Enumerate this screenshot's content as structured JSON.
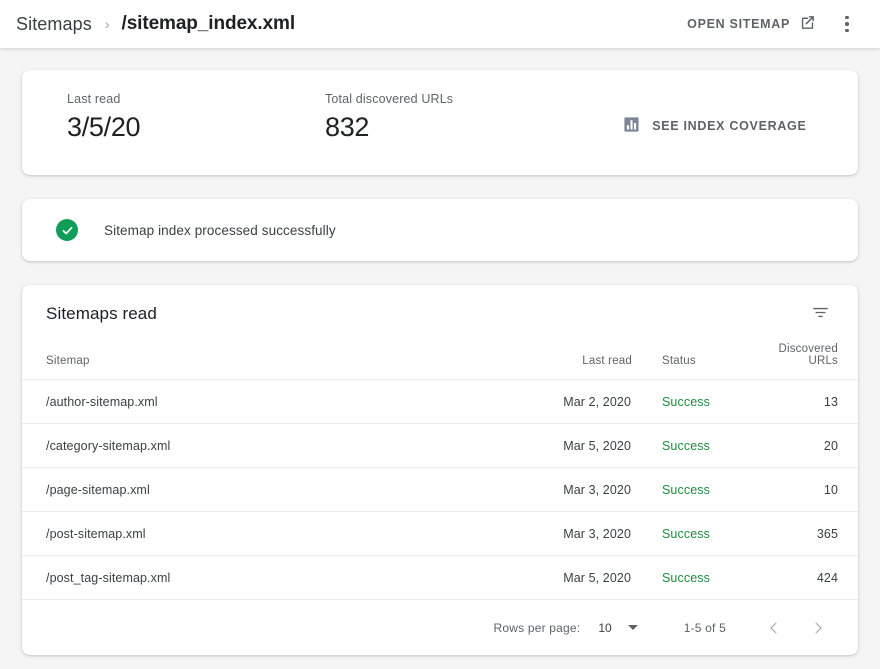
{
  "header": {
    "breadcrumb_root": "Sitemaps",
    "breadcrumb_separator": "›",
    "breadcrumb_current": "/sitemap_index.xml",
    "open_sitemap_label": "OPEN SITEMAP",
    "open_sitemap_icon": "external-link-icon",
    "overflow_icon": "more-vert-icon"
  },
  "summary": {
    "last_read_label": "Last read",
    "last_read_value": "3/5/20",
    "total_urls_label": "Total discovered URLs",
    "total_urls_value": "832",
    "coverage_label": "SEE INDEX COVERAGE",
    "coverage_icon": "bar-chart-icon"
  },
  "status": {
    "icon": "check-circle-icon",
    "icon_color": "#0f9d58",
    "message": "Sitemap index processed successfully"
  },
  "table": {
    "title": "Sitemaps read",
    "filter_icon": "filter-list-icon",
    "columns": [
      "Sitemap",
      "Last read",
      "Status",
      "Discovered URLs"
    ],
    "rows": [
      {
        "sitemap": "/author-sitemap.xml",
        "last_read": "Mar 2, 2020",
        "status": "Success",
        "urls": "13"
      },
      {
        "sitemap": "/category-sitemap.xml",
        "last_read": "Mar 5, 2020",
        "status": "Success",
        "urls": "20"
      },
      {
        "sitemap": "/page-sitemap.xml",
        "last_read": "Mar 3, 2020",
        "status": "Success",
        "urls": "10"
      },
      {
        "sitemap": "/post-sitemap.xml",
        "last_read": "Mar 3, 2020",
        "status": "Success",
        "urls": "365"
      },
      {
        "sitemap": "/post_tag-sitemap.xml",
        "last_read": "Mar 5, 2020",
        "status": "Success",
        "urls": "424"
      }
    ],
    "status_color": "#1e8e3e"
  },
  "pagination": {
    "rows_per_page_label": "Rows per page:",
    "rows_per_page_value": "10",
    "range_label": "1-5 of 5",
    "prev_icon": "chevron-left-icon",
    "next_icon": "chevron-right-icon"
  }
}
